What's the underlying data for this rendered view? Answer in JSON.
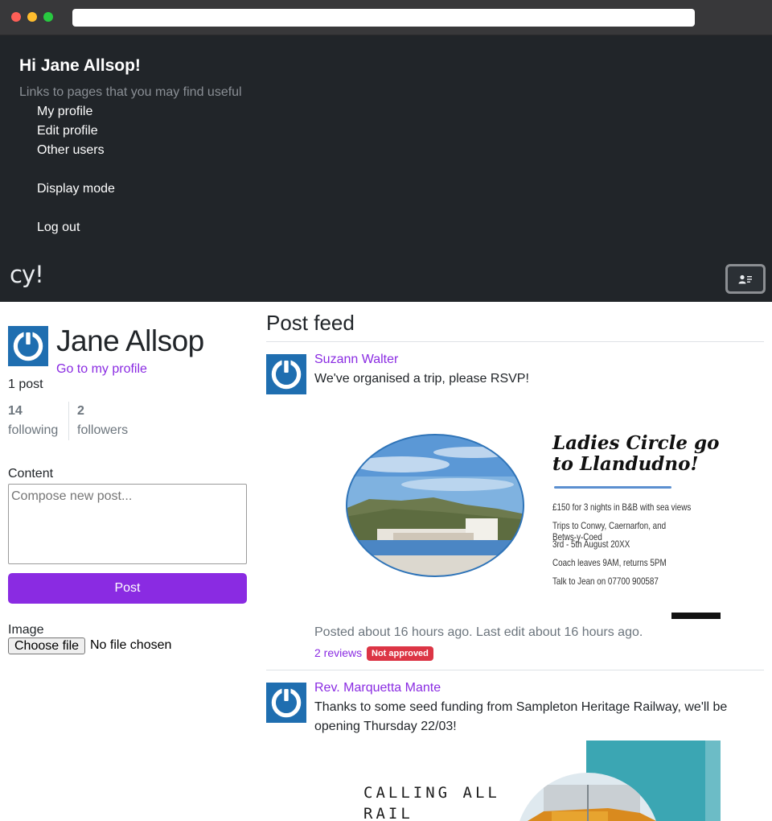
{
  "browser": {
    "url": ""
  },
  "navbar": {
    "greeting": "Hi Jane Allsop!",
    "subtitle": "Links to pages that you may find useful",
    "links": [
      "My profile",
      "Edit profile",
      "Other users",
      "Display mode",
      "Log out"
    ],
    "brand": "cy!",
    "toggler_icon": "contact-card-icon"
  },
  "profile": {
    "name": "Jane Allsop",
    "profile_link": "Go to my profile",
    "post_count": "1 post",
    "following_count": "14",
    "following_label": "following",
    "followers_count": "2",
    "followers_label": "followers"
  },
  "composer": {
    "content_label": "Content",
    "placeholder": "Compose new post...",
    "post_button": "Post",
    "image_label": "Image",
    "file_button": "Choose file",
    "file_status": "No file chosen"
  },
  "feed": {
    "title": "Post feed",
    "posts": [
      {
        "author": "Suzann Walter",
        "text": "We've organised a trip, please RSVP!",
        "poster": {
          "title_line1": "Ladies Circle go",
          "title_line2": "to Llandudno!",
          "lines": [
            "£150 for 3 nights in B&B with sea views",
            "Trips to Conwy, Caernarfon, and Betws-y-Coed",
            "3rd - 5th August 20XX",
            "Coach leaves 9AM, returns 5PM",
            "Talk to Jean on 07700 900587"
          ]
        },
        "meta": "Posted about 16 hours ago. Last edit about 16 hours ago.",
        "reviews": "2 reviews",
        "badge": "Not approved"
      },
      {
        "author": "Rev. Marquetta Mante",
        "text_line1": "Thanks to some seed funding from Sampleton Heritage Railway, we'll be",
        "text_line2": "opening Thursday 22/03!",
        "poster": {
          "line1": "CALLING ALL",
          "line2": "RAIL"
        }
      }
    ]
  },
  "colors": {
    "accent": "#8a2be2",
    "navbar_bg": "#212529",
    "badge_danger": "#dc3545",
    "avatar_blue": "#1f6eb0"
  }
}
